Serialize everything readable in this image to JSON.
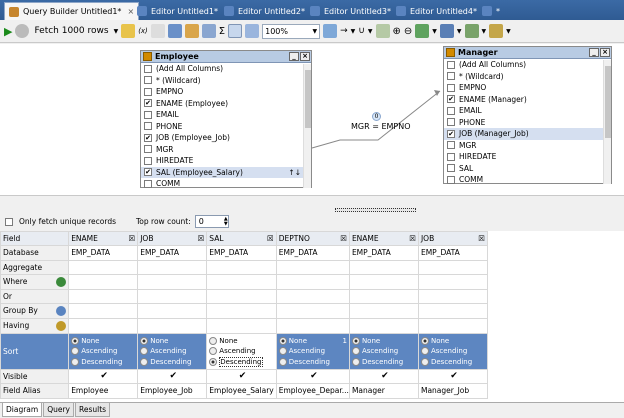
{
  "tabs": [
    {
      "label": "Query Builder Untitled1*",
      "close": "×",
      "active": true
    },
    {
      "label": "Editor Untitled1*",
      "active": false
    },
    {
      "label": "Editor Untitled2*",
      "active": false
    },
    {
      "label": "Editor Untitled3*",
      "active": false
    },
    {
      "label": "Editor Untitled4*",
      "active": false
    },
    {
      "label": "*",
      "active": false
    }
  ],
  "toolbar": {
    "fetch_label": "Fetch 1000 rows",
    "zoom": "100%"
  },
  "employee": {
    "title": "Employee",
    "rows": [
      {
        "label": "(Add All Columns)",
        "checked": false
      },
      {
        "label": "* (Wildcard)",
        "checked": false
      },
      {
        "label": "EMPNO",
        "checked": false
      },
      {
        "label": "ENAME (Employee)",
        "checked": true
      },
      {
        "label": "EMAIL",
        "checked": false
      },
      {
        "label": "PHONE",
        "checked": false
      },
      {
        "label": "JOB (Employee_Job)",
        "checked": true
      },
      {
        "label": "MGR",
        "checked": false
      },
      {
        "label": "HIREDATE",
        "checked": false
      },
      {
        "label": "SAL (Employee_Salary)",
        "checked": true,
        "selected": true,
        "sort_marker": "↑↓"
      },
      {
        "label": "COMM",
        "checked": false
      }
    ]
  },
  "manager": {
    "title": "Manager",
    "rows": [
      {
        "label": "(Add All Columns)",
        "checked": false
      },
      {
        "label": "* (Wildcard)",
        "checked": false
      },
      {
        "label": "EMPNO",
        "checked": false
      },
      {
        "label": "ENAME (Manager)",
        "checked": true
      },
      {
        "label": "EMAIL",
        "checked": false
      },
      {
        "label": "PHONE",
        "checked": false
      },
      {
        "label": "JOB (Manager_Job)",
        "checked": true,
        "selected": true
      },
      {
        "label": "MGR",
        "checked": false
      },
      {
        "label": "HIREDATE",
        "checked": false
      },
      {
        "label": "SAL",
        "checked": false
      },
      {
        "label": "COMM",
        "checked": false
      }
    ]
  },
  "join": {
    "label": "MGR = EMPNO",
    "badge": "0"
  },
  "options": {
    "unique_label": "Only fetch unique records",
    "top_row_label": "Top row count:",
    "top_row_value": "0"
  },
  "grid": {
    "row_labels": [
      "Field",
      "Database",
      "Aggregate",
      "Where",
      "Or",
      "Group By",
      "Having",
      "Sort",
      "Visible",
      "Field Alias"
    ],
    "columns": [
      {
        "field": "ENAME",
        "database": "EMP_DATA",
        "sort": "None",
        "sort_index": "",
        "visible": true,
        "alias": "Employee"
      },
      {
        "field": "JOB",
        "database": "EMP_DATA",
        "sort": "None",
        "sort_index": "",
        "visible": true,
        "alias": "Employee_Job"
      },
      {
        "field": "SAL",
        "database": "EMP_DATA",
        "sort": "Descending",
        "sort_index": "",
        "visible": true,
        "alias": "Employee_Salary"
      },
      {
        "field": "DEPTNO",
        "database": "EMP_DATA",
        "sort": "None",
        "sort_index": "1",
        "visible": true,
        "alias": "Employee_Depar..."
      },
      {
        "field": "ENAME",
        "database": "EMP_DATA",
        "sort": "None",
        "sort_index": "",
        "visible": true,
        "alias": "Manager"
      },
      {
        "field": "JOB",
        "database": "EMP_DATA",
        "sort": "None",
        "sort_index": "",
        "visible": true,
        "alias": "Manager_Job"
      }
    ],
    "sort_options": [
      "None",
      "Ascending",
      "Descending"
    ]
  },
  "bottom_tabs": [
    "Diagram",
    "Query",
    "Results"
  ]
}
